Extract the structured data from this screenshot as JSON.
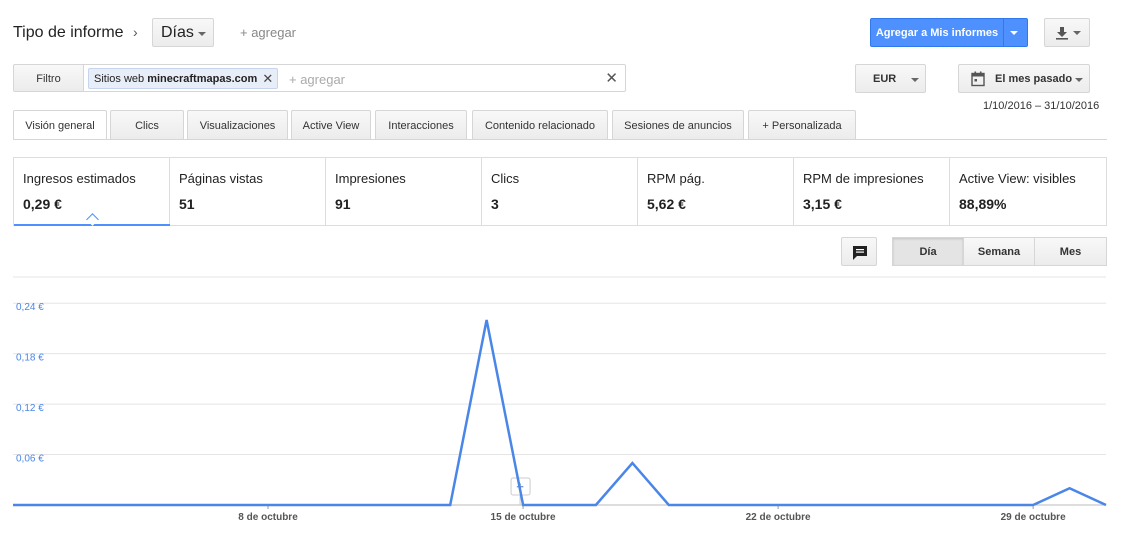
{
  "header": {
    "title": "Tipo de informe",
    "granularity": "Días",
    "add_label": "+ agregar",
    "add_to_reports": "Agregar a Mis informes"
  },
  "filter": {
    "label": "Filtro",
    "chip_prefix": "Sitios web",
    "chip_value": "minecraftmapas.com",
    "add_placeholder": "+ agregar"
  },
  "currency": "EUR",
  "date": {
    "preset": "El mes pasado",
    "range": "1/10/2016 – 31/10/2016"
  },
  "tabs": [
    {
      "label": "Visión general",
      "active": true
    },
    {
      "label": "Clics"
    },
    {
      "label": "Visualizaciones"
    },
    {
      "label": "Active View"
    },
    {
      "label": "Interacciones"
    },
    {
      "label": "Contenido relacionado"
    },
    {
      "label": "Sesiones de anuncios"
    },
    {
      "label": "Personalizada"
    }
  ],
  "metrics": [
    {
      "label": "Ingresos estimados",
      "value": "0,29 €"
    },
    {
      "label": "Páginas vistas",
      "value": "51"
    },
    {
      "label": "Impresiones",
      "value": "91"
    },
    {
      "label": "Clics",
      "value": "3"
    },
    {
      "label": "RPM pág.",
      "value": "5,62 €"
    },
    {
      "label": "RPM de impresiones",
      "value": "3,15 €"
    },
    {
      "label": "Active View: visibles",
      "value": "88,89%"
    }
  ],
  "granularity_toggle": [
    "Día",
    "Semana",
    "Mes"
  ],
  "icons": {
    "download": "download-icon",
    "calendar": "calendar-icon",
    "annotation": "comment-icon"
  },
  "colors": {
    "accent": "#4d90fe",
    "line": "#4a86e8"
  },
  "chart_data": {
    "type": "line",
    "title": "",
    "xlabel": "",
    "ylabel": "",
    "ylim": [
      0,
      0.27
    ],
    "y_ticks": [
      "0,06 €",
      "0,12 €",
      "0,18 €",
      "0,24 €"
    ],
    "y_tick_values": [
      0.06,
      0.12,
      0.18,
      0.24
    ],
    "x_ticks": [
      "8 de octubre",
      "15 de octubre",
      "22 de octubre",
      "29 de octubre"
    ],
    "x_tick_days": [
      8,
      15,
      22,
      29
    ],
    "x_unit": "day of October 2016",
    "series": [
      {
        "x": [
          1,
          2,
          3,
          4,
          5,
          6,
          7,
          8,
          9,
          10,
          11,
          12,
          13,
          14,
          15,
          16,
          17,
          18,
          19,
          20,
          21,
          22,
          23,
          24,
          25,
          26,
          27,
          28,
          29,
          30,
          31
        ],
        "values": [
          0,
          0,
          0,
          0,
          0,
          0,
          0,
          0,
          0,
          0,
          0,
          0,
          0,
          0.22,
          0,
          0,
          0,
          0.05,
          0,
          0,
          0,
          0,
          0,
          0,
          0,
          0,
          0,
          0,
          0,
          0.02,
          0
        ]
      }
    ]
  }
}
